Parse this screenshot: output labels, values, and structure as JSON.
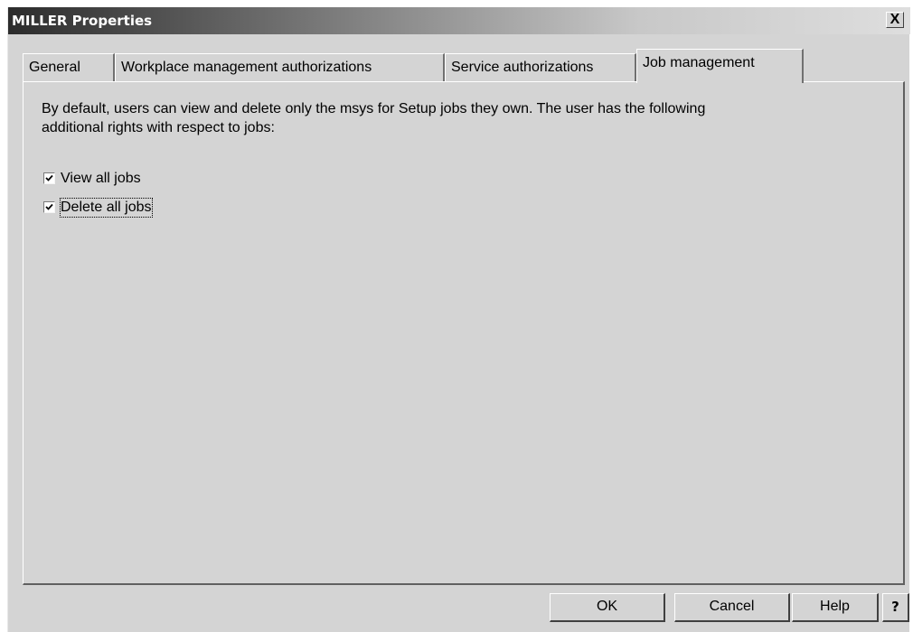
{
  "window": {
    "title": "MILLER Properties",
    "close_glyph": "X"
  },
  "tabs": [
    {
      "label": "General",
      "active": false
    },
    {
      "label": "Workplace management authorizations",
      "active": false
    },
    {
      "label": "Service authorizations",
      "active": false
    },
    {
      "label": "Job management",
      "active": true
    }
  ],
  "panel": {
    "description": "By default, users can view and delete only the msys for Setup jobs they own. The user has the following additional rights with respect to jobs:",
    "options": [
      {
        "label": "View all jobs",
        "checked": true
      },
      {
        "label": "Delete all jobs",
        "checked": true
      }
    ]
  },
  "buttons": {
    "ok": "OK",
    "cancel": "Cancel",
    "help": "Help",
    "context_help": "?"
  },
  "colors": {
    "dialog_background": "#d4d4d4",
    "title_text": "#ffffff"
  }
}
